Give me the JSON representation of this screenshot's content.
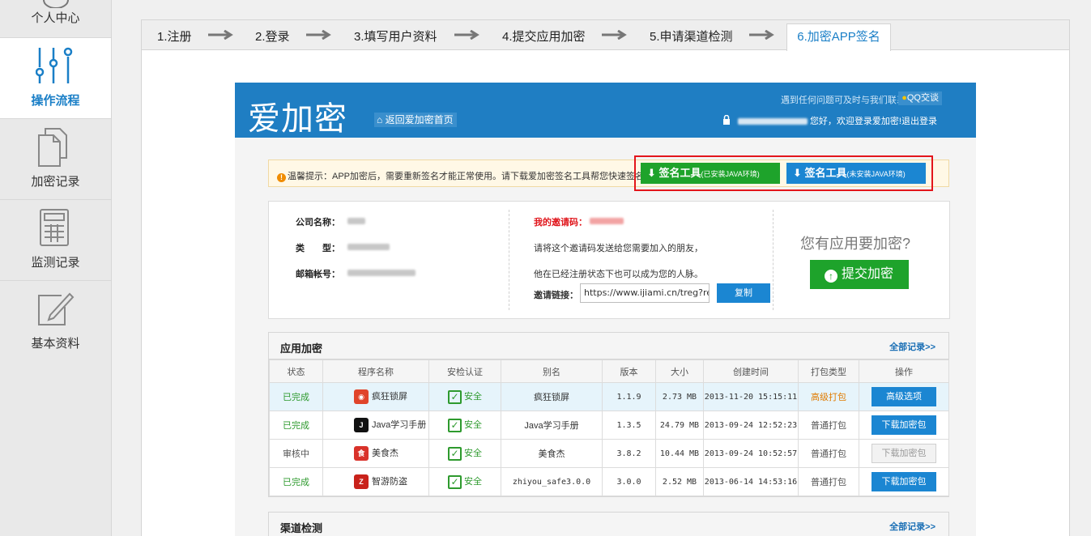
{
  "sidebar": {
    "items": [
      {
        "label": "个人中心",
        "icon": "user-icon"
      },
      {
        "label": "操作流程",
        "icon": "sliders-icon",
        "active": true
      },
      {
        "label": "加密记录",
        "icon": "documents-icon"
      },
      {
        "label": "监测记录",
        "icon": "calculator-icon"
      },
      {
        "label": "基本资料",
        "icon": "edit-icon"
      }
    ]
  },
  "steps": [
    "1.注册",
    "2.登录",
    "3.填写用户资料",
    "4.提交应用加密",
    "5.申请渠道检测",
    "6.加密APP签名"
  ],
  "header": {
    "logo": "爱加密",
    "home_link": "返回爱加密首页",
    "contact": "遇到任何问题可及时与我们联系!",
    "qq": "QQ交谈",
    "greeting": "您好，欢迎登录爱加密!",
    "logout": "退出登录"
  },
  "tip": {
    "text": "温馨提示：APP加密后，需要重新签名才能正常使用。请下载爱加密签名工具帮您快速签名!",
    "btn_installed": "签名工具",
    "btn_installed_note": "(已安装JAVA环境)",
    "btn_not_installed": "签名工具",
    "btn_not_installed_note": "(未安装JAVA环境)"
  },
  "info": {
    "company_label": "公司名称：",
    "type_label": "类　　型：",
    "email_label": "邮箱帐号：",
    "invite_code_label": "我的邀请码：",
    "invite_hint1": "请将这个邀请码发送给您需要加入的朋友，",
    "invite_hint2": "他在已经注册状态下也可以成为您的人脉。",
    "invite_link_label": "邀请链接：",
    "invite_link": "https://www.ijiami.cn/treg?reg",
    "copy": "复制",
    "ask": "您有应用要加密?",
    "submit": "提交加密"
  },
  "apps": {
    "title": "应用加密",
    "all": "全部记录>>",
    "columns": [
      "状态",
      "程序名称",
      "安检认证",
      "别名",
      "版本",
      "大小",
      "创建时间",
      "打包类型",
      "操作"
    ],
    "rows": [
      {
        "status": "已完成",
        "name": "疯狂锁屏",
        "cert": "安全",
        "alias": "疯狂锁屏",
        "version": "1.1.9",
        "size": "2.73 MB",
        "created": "2013-11-20 15:15:11",
        "pack": "高级打包",
        "action": "高级选项",
        "icon_color": "#e0442a"
      },
      {
        "status": "已完成",
        "name": "Java学习手册",
        "cert": "安全",
        "alias": "Java学习手册",
        "version": "1.3.5",
        "size": "24.79 MB",
        "created": "2013-09-24 12:52:23",
        "pack": "普通打包",
        "action": "下载加密包",
        "icon_color": "#111111"
      },
      {
        "status": "审核中",
        "name": "美食杰",
        "cert": "安全",
        "alias": "美食杰",
        "version": "3.8.2",
        "size": "10.44 MB",
        "created": "2013-09-24 10:52:57",
        "pack": "普通打包",
        "action": "下载加密包",
        "icon_color": "#d9322a"
      },
      {
        "status": "已完成",
        "name": "智游防盗",
        "cert": "安全",
        "alias": "zhiyou_safe3.0.0",
        "version": "3.0.0",
        "size": "2.52 MB",
        "created": "2013-06-14 14:53:16",
        "pack": "普通打包",
        "action": "下载加密包",
        "icon_color": "#c9221b"
      }
    ]
  },
  "channel": {
    "title": "渠道检测",
    "all": "全部记录>>"
  }
}
